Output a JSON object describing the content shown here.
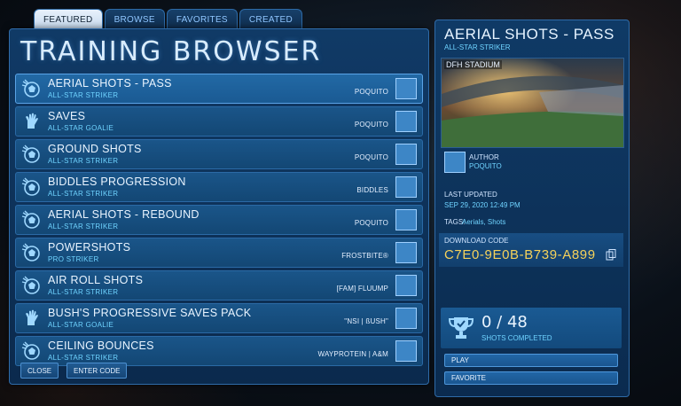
{
  "tabs": [
    "FEATURED",
    "BROWSE",
    "FAVORITES",
    "CREATED"
  ],
  "panel_title": "TRAINING BROWSER",
  "packs": [
    {
      "name": "AERIAL SHOTS - PASS",
      "difficulty": "ALL-STAR STRIKER",
      "author": "POQUITO",
      "icon": "ball-strike-icon"
    },
    {
      "name": "SAVES",
      "difficulty": "ALL-STAR GOALIE",
      "author": "POQUITO",
      "icon": "goalie-glove-icon"
    },
    {
      "name": "GROUND SHOTS",
      "difficulty": "ALL-STAR STRIKER",
      "author": "POQUITO",
      "icon": "ball-strike-icon"
    },
    {
      "name": "BIDDLES PROGRESSION",
      "difficulty": "ALL-STAR STRIKER",
      "author": "BIDDLES",
      "icon": "ball-strike-icon"
    },
    {
      "name": "AERIAL SHOTS - REBOUND",
      "difficulty": "ALL-STAR STRIKER",
      "author": "POQUITO",
      "icon": "ball-strike-icon"
    },
    {
      "name": "POWERSHOTS",
      "difficulty": "PRO STRIKER",
      "author": "FROSTBITE®",
      "icon": "ball-strike-icon"
    },
    {
      "name": "AIR ROLL SHOTS",
      "difficulty": "ALL-STAR STRIKER",
      "author": "[FAM] FLUUMP",
      "icon": "ball-strike-icon"
    },
    {
      "name": "BUSH'S PROGRESSIVE SAVES PACK",
      "difficulty": "ALL-STAR GOALIE",
      "author": "\"NSI | ßUSH\"",
      "icon": "goalie-glove-icon"
    },
    {
      "name": "CEILING BOUNCES",
      "difficulty": "ALL-STAR STRIKER",
      "author": "WAYPROTEIN | A&M",
      "icon": "ball-strike-icon"
    }
  ],
  "buttons": {
    "close": "CLOSE",
    "enter_code": "ENTER CODE"
  },
  "detail": {
    "title": "AERIAL SHOTS - PASS",
    "difficulty": "ALL-STAR STRIKER",
    "arena": "DFH STADIUM",
    "author_label": "AUTHOR",
    "author": "POQUITO",
    "updated_label": "LAST UPDATED",
    "updated": "SEP 29, 2020 12:49 PM",
    "tags_label": "TAGS:",
    "tags": "Aerials, Shots",
    "code_label": "DOWNLOAD CODE",
    "code": "C7E0-9E0B-B739-A899",
    "shots_completed": "0",
    "shots_total": "48",
    "shots_label": "SHOTS COMPLETED",
    "play": "PLAY",
    "favorite": "FAVORITE"
  },
  "colors": {
    "accent": "#6fd3ff",
    "code": "#f6d25a",
    "panel": "#103a66"
  }
}
